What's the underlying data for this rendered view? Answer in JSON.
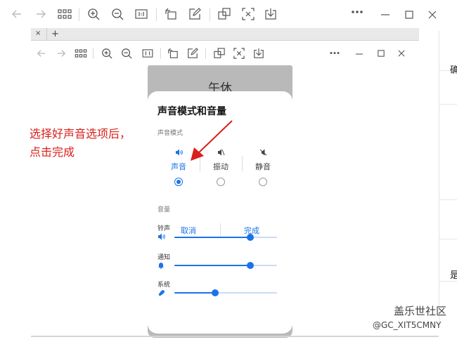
{
  "outer_toolbar": {
    "icons": [
      "back-arrow-icon",
      "forward-arrow-icon",
      "grid-view-icon",
      "zoom-in-icon",
      "zoom-out-icon",
      "actual-size-icon",
      "rotate-icon",
      "edit-icon",
      "crop-icon",
      "screen-capture-icon",
      "download-icon",
      "more-icon",
      "minimize-icon",
      "maximize-icon",
      "close-icon"
    ]
  },
  "tabbar": {
    "close_glyph": "×",
    "new_tab_glyph": "+"
  },
  "inner_toolbar": {
    "icons": [
      "back-arrow-icon",
      "forward-arrow-icon",
      "grid-view-icon",
      "zoom-in-icon",
      "zoom-out-icon",
      "actual-size-icon",
      "rotate-icon",
      "edit-icon",
      "crop-icon",
      "screen-capture-icon",
      "download-icon",
      "more-icon",
      "minimize-icon",
      "maximize-icon",
      "close-icon"
    ]
  },
  "phone": {
    "background_title": "午休",
    "dialog": {
      "title": "声音模式和音量",
      "mode_section_label": "声音模式",
      "modes": [
        {
          "label": "声音",
          "icon": "speaker-icon",
          "selected": true
        },
        {
          "label": "振动",
          "icon": "vibrate-icon",
          "selected": false
        },
        {
          "label": "静音",
          "icon": "mute-icon",
          "selected": false
        }
      ],
      "volume_section_label": "音量",
      "volumes": [
        {
          "label": "铃声",
          "icon": "speaker-icon",
          "level": 0.74
        },
        {
          "label": "通知",
          "icon": "bell-icon",
          "level": 0.74
        },
        {
          "label": "系统",
          "icon": "wrench-icon",
          "level": 0.4
        }
      ],
      "cancel_label": "取消",
      "done_label": "完成"
    }
  },
  "annotation": {
    "line1": "选择好声音选项后，",
    "line2": "点击完成",
    "color": "#d8201c"
  },
  "right_edge": {
    "char1": "确",
    "char2": "是"
  },
  "watermark": {
    "title": "盖乐世社区",
    "handle": "@GC_XIT5CMNY"
  },
  "colors": {
    "accent": "#1a73e8",
    "annotation": "#d8201c"
  }
}
